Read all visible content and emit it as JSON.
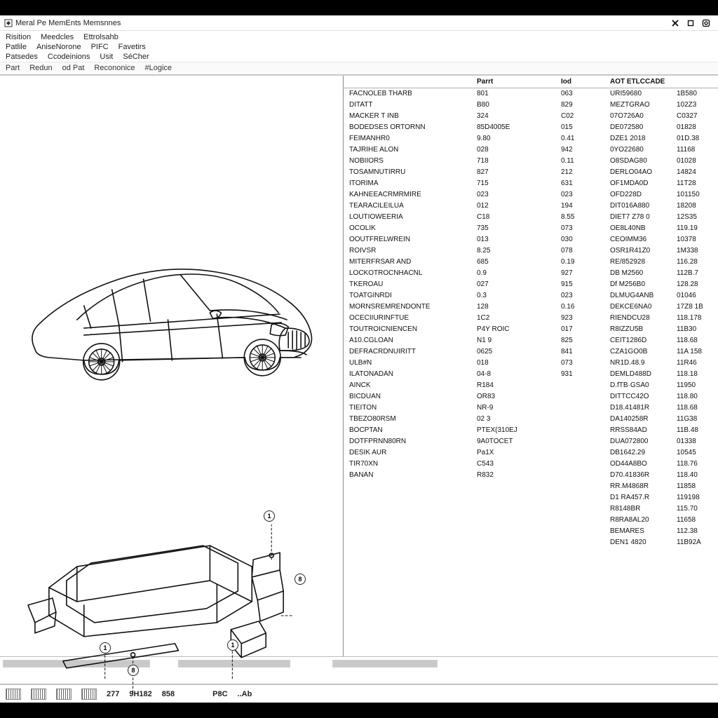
{
  "titlebar": {
    "title": "Meral Pe MemEnts Memsnnes"
  },
  "menubar": {
    "rows": [
      [
        "Risition",
        "Meedcles",
        "Ettrolsahb"
      ],
      [
        "Patlile",
        "AniseNorone",
        "PIFC",
        "Favetirs"
      ],
      [
        "Patsedes",
        "Ccodeinions",
        "Usit",
        "SéCher"
      ]
    ]
  },
  "toolbar": {
    "items": [
      "Part",
      "Redun",
      "od Pat",
      "Recononice",
      "#Logice"
    ]
  },
  "table": {
    "headers": {
      "name": "",
      "part": "Parrt",
      "id": "Iod",
      "ref": "AOT ETLCCADE",
      "ext": ""
    },
    "rows": [
      {
        "n": "FACNOLEB THARB",
        "p": "801",
        "i": "063",
        "r": "URI59680",
        "e": "1B580"
      },
      {
        "n": "DITATT",
        "p": "B80",
        "i": "829",
        "r": "MEZTGRAO",
        "e": "102Z3"
      },
      {
        "n": "MACKER T INB",
        "p": "324",
        "i": "C02",
        "r": "07O726A0",
        "e": "C0327"
      },
      {
        "n": "BODEDSES ORTORNN",
        "p": "85D4005E",
        "i": "015",
        "r": "DE072580",
        "e": "01828"
      },
      {
        "n": "FEIMANHR0",
        "p": "9.80",
        "i": "0.41",
        "r": "DZE1 2018",
        "e": "01D.38"
      },
      {
        "n": "TAJRIHE ALON",
        "p": "028",
        "i": "942",
        "r": "0YO22680",
        "e": "11168"
      },
      {
        "n": "NOBIIORS",
        "p": "718",
        "i": "0.11",
        "r": "O8SDAG80",
        "e": "01028"
      },
      {
        "n": "TOSAMNUTIRRU",
        "p": "827",
        "i": "212",
        "r": "DERLO04AO",
        "e": "14824"
      },
      {
        "n": "ITORIMA",
        "p": "715",
        "i": "631",
        "r": "OF1MDA0D",
        "e": "11T28"
      },
      {
        "n": "KAHNEEACRMRMIRE",
        "p": "023",
        "i": "023",
        "r": "OFD228D",
        "e": "101150"
      },
      {
        "n": "TEARACILEILUA",
        "p": "012",
        "i": "194",
        "r": "DIT016A880",
        "e": "18208"
      },
      {
        "n": "LOUTIOWEERIA",
        "p": "C18",
        "i": "8.55",
        "r": "DIET7 Z78 0",
        "e": "12S35"
      },
      {
        "n": "OCOLIK",
        "p": "735",
        "i": "073",
        "r": "OE8L40NB",
        "e": "119.19"
      },
      {
        "n": "OOUTFRELWREIN",
        "p": "013",
        "i": "030",
        "r": "CEOIMM36",
        "e": "10378"
      },
      {
        "n": "ROIVSR",
        "p": "8.25",
        "i": "078",
        "r": "OSR1R41Z0",
        "e": "1M338"
      },
      {
        "n": "MITERFRSAR AND",
        "p": "685",
        "i": "0.19",
        "r": "RE/852928",
        "e": "116.28"
      },
      {
        "n": "LOCKOTROCNHACNL",
        "p": "0.9",
        "i": "927",
        "r": "DB M2560",
        "e": "112B.7"
      },
      {
        "n": "TKEROAU",
        "p": "027",
        "i": "915",
        "r": "Df M256B0",
        "e": "128.28"
      },
      {
        "n": "TOATGINRDI",
        "p": "0.3",
        "i": "023",
        "r": "DLMUG4ANB",
        "e": "01046"
      },
      {
        "n": "MORNSREMRENDONTE",
        "p": "128",
        "i": "0.16",
        "r": "DEKCE6NA0",
        "e": "17Z8 1B"
      },
      {
        "n": "OCECIIURINFTUE",
        "p": "1C2",
        "i": "923",
        "r": "RIENDCU28",
        "e": "118.178"
      },
      {
        "n": "TOUTROICNIENCEN",
        "p": "P4Y ROIC",
        "i": "017",
        "r": "R8IZZU5B",
        "e": "11B30"
      },
      {
        "n": "A10.CGLOAN",
        "p": "N1 9",
        "i": "825",
        "r": "CEIT1286D",
        "e": "118.68"
      },
      {
        "n": "DEFRACRDNUIRITT",
        "p": "0625",
        "i": "841",
        "r": "CZA1GO0B",
        "e": "11A 158"
      },
      {
        "n": "ULB#N",
        "p": "018",
        "i": "073",
        "r": "NR1D.48.9",
        "e": "11R46"
      },
      {
        "n": "ILATONADAN",
        "p": "04-8",
        "i": "931",
        "r": "DEMLD488D",
        "e": "118.18"
      },
      {
        "n": "AINCK",
        "p": "R184",
        "i": "",
        "r": "D.fTB·GSA0",
        "e": "11950"
      },
      {
        "n": "BICDUAN",
        "p": "OR83",
        "i": "",
        "r": "DITTCC42O",
        "e": "118.80"
      },
      {
        "n": "TIEITON",
        "p": "NR-9",
        "i": "",
        "r": "D18.41481R",
        "e": "118.68"
      },
      {
        "n": "TBEZO80RSM",
        "p": "02 3",
        "i": "",
        "r": "DA140258R",
        "e": "11G38"
      },
      {
        "n": "BOCPTAN",
        "p": "PTEX(310EJ",
        "i": "",
        "r": "RRSS84AD",
        "e": "11B.48"
      },
      {
        "n": "DOTFPRNN80RN",
        "p": "9A0TOCET",
        "i": "",
        "r": "DUA072800",
        "e": "01338"
      },
      {
        "n": "DESIK AUR",
        "p": "Pa1X",
        "i": "",
        "r": "DB1642.29",
        "e": "10545"
      },
      {
        "n": "TIR70XN",
        "p": "C543",
        "i": "",
        "r": "OD44A8BO",
        "e": "118.76"
      },
      {
        "n": "BANAN",
        "p": "R832",
        "i": "",
        "r": "D70.41836R",
        "e": "118.40"
      },
      {
        "n": "",
        "p": "",
        "i": "",
        "r": "RR.M4868R",
        "e": "11858"
      },
      {
        "n": "",
        "p": "",
        "i": "",
        "r": "D1 RA457.R",
        "e": "119198"
      },
      {
        "n": "",
        "p": "",
        "i": "",
        "r": "R8148BR",
        "e": "115.70"
      },
      {
        "n": "",
        "p": "",
        "i": "",
        "r": "R8RA8AL20",
        "e": "11658"
      },
      {
        "n": "",
        "p": "",
        "i": "",
        "r": "BEMARES",
        "e": "112.38"
      },
      {
        "n": "",
        "p": "",
        "i": "",
        "r": "DEN1 4820",
        "e": "11B92A"
      }
    ]
  },
  "statusbar": {
    "items": [
      "277",
      "9H182",
      "858",
      "P8C",
      "..Ab"
    ]
  },
  "callouts": {
    "a": "1",
    "b": "8",
    "c": "1",
    "d": "1",
    "e": "8"
  }
}
